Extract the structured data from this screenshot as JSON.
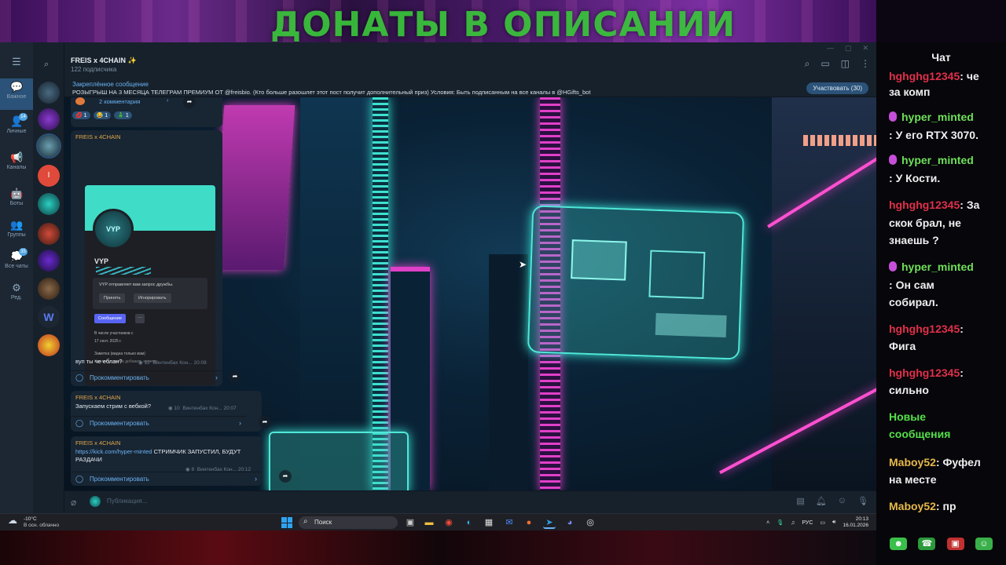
{
  "overlay": {
    "donate_text": "ДОНАТЫ В ОПИСАНИИ"
  },
  "telegram": {
    "channel_title": "FREIS x 4CHAIN",
    "subscribers": "122 подписчика",
    "pinned": {
      "label": "Закреплённое сообщение",
      "text": "РОЗЫГРЫШ НА 3 МЕСЯЦА ТЕЛЕГРАМ ПРЕМИУМ ОТ @freisbio. (Кто больше разошлет этот пост получит дополнительный приз) Условия: Быть подписанным на все каналы в @HGifts_bot",
      "button": "Участвовать (30)"
    },
    "rail": [
      {
        "label": "Важное",
        "badge": ""
      },
      {
        "label": "Личные",
        "badge": "14"
      },
      {
        "label": "Каналы",
        "badge": ""
      },
      {
        "label": "Боты",
        "badge": ""
      },
      {
        "label": "Группы",
        "badge": ""
      },
      {
        "label": "Все чаты",
        "badge": "35"
      },
      {
        "label": "Ред.",
        "badge": ""
      }
    ],
    "top_post": {
      "comments": "2 комментария",
      "reactions": [
        {
          "emoji": "💋",
          "count": "1"
        },
        {
          "emoji": "😂",
          "count": "1"
        },
        {
          "emoji": "🎄",
          "count": "1"
        }
      ]
    },
    "post1": {
      "author": "FREIS x 4CHAIN",
      "card": {
        "avatar_text": "VYP",
        "name": "VYP",
        "request": "VYP отправляет вам запрос дружбы.",
        "accept": "Принять",
        "ignore": "Игнорировать",
        "message_btn": "Сообщение",
        "member_since": "В числе участников с",
        "member_date": "17 сент. 2025 г.",
        "note_title": "Заметка (видна только вам)",
        "note_hint": "Нажмите, чтобы добавить заметку"
      },
      "text": "вуп ты че еблан?",
      "views": "12",
      "signature": "Винтенбах Кон...",
      "time": "20:08",
      "comment_label": "Прокомментировать"
    },
    "post2": {
      "author": "FREIS x 4CHAIN",
      "text": "Запускаем стрим с вебкой?",
      "views": "10",
      "signature": "Винтенбах Кон...",
      "time": "20:07",
      "comment_label": "Прокомментировать"
    },
    "post3": {
      "author": "FREIS x 4CHAIN",
      "link": "https://kick.com/hyper-minted",
      "text": " СТРИМЧИК ЗАПУСТИЛ, БУДУТ РАЗДАЧИ",
      "views": "8",
      "signature": "Винтенбах Кон...",
      "time": "20:12",
      "comment_label": "Прокомментировать"
    },
    "composer_placeholder": "Публикация..."
  },
  "taskbar": {
    "temp": "-10°C",
    "weather": "В осн. облачно",
    "search": "Поиск",
    "lang": "РУС",
    "time": "20:13",
    "date": "16.01.2026"
  },
  "chat": {
    "title": "Чат",
    "messages": [
      {
        "user": "hghghg12345",
        "sep": ": ",
        "text": "че",
        "badge": false
      },
      {
        "user": "",
        "sep": "",
        "text": "за комп",
        "badge": false
      },
      {
        "user": "hyper_minted",
        "sep": "",
        "text": "",
        "badge": true
      },
      {
        "user": "",
        "sep": ": ",
        "text": "У его RTX 3070.",
        "badge": false
      },
      {
        "user": "hyper_minted",
        "sep": "",
        "text": "",
        "badge": true
      },
      {
        "user": "",
        "sep": ": ",
        "text": "У Кости.",
        "badge": false
      },
      {
        "user": "hghghg12345",
        "sep": ": ",
        "text": "За",
        "badge": false
      },
      {
        "user": "",
        "sep": "",
        "text": "скок брал, не",
        "badge": false
      },
      {
        "user": "",
        "sep": "",
        "text": "знаешь ?",
        "badge": false
      },
      {
        "user": "hyper_minted",
        "sep": "",
        "text": "",
        "badge": true
      },
      {
        "user": "",
        "sep": ": ",
        "text": "Он сам",
        "badge": false
      },
      {
        "user": "",
        "sep": "",
        "text": "собирал.",
        "badge": false
      },
      {
        "user": "hghghg12345",
        "sep": ":",
        "text": "",
        "badge": false
      },
      {
        "user": "",
        "sep": "",
        "text": "Фига",
        "badge": false
      },
      {
        "user": "hghghg12345",
        "sep": ":",
        "text": "",
        "badge": false
      },
      {
        "user": "",
        "sep": "",
        "text": "сильно",
        "badge": false
      },
      {
        "user": "",
        "sep": "",
        "text": "Новые",
        "badge": false
      },
      {
        "user": "",
        "sep": "",
        "text": "сообщения",
        "badge": false
      },
      {
        "user": "Maboy52",
        "sep": ": ",
        "text": "Фуфел",
        "badge": false
      },
      {
        "user": "",
        "sep": "",
        "text": "на месте",
        "badge": false
      },
      {
        "user": "Maboy52",
        "sep": ": ",
        "text": "пр",
        "badge": false
      }
    ]
  }
}
